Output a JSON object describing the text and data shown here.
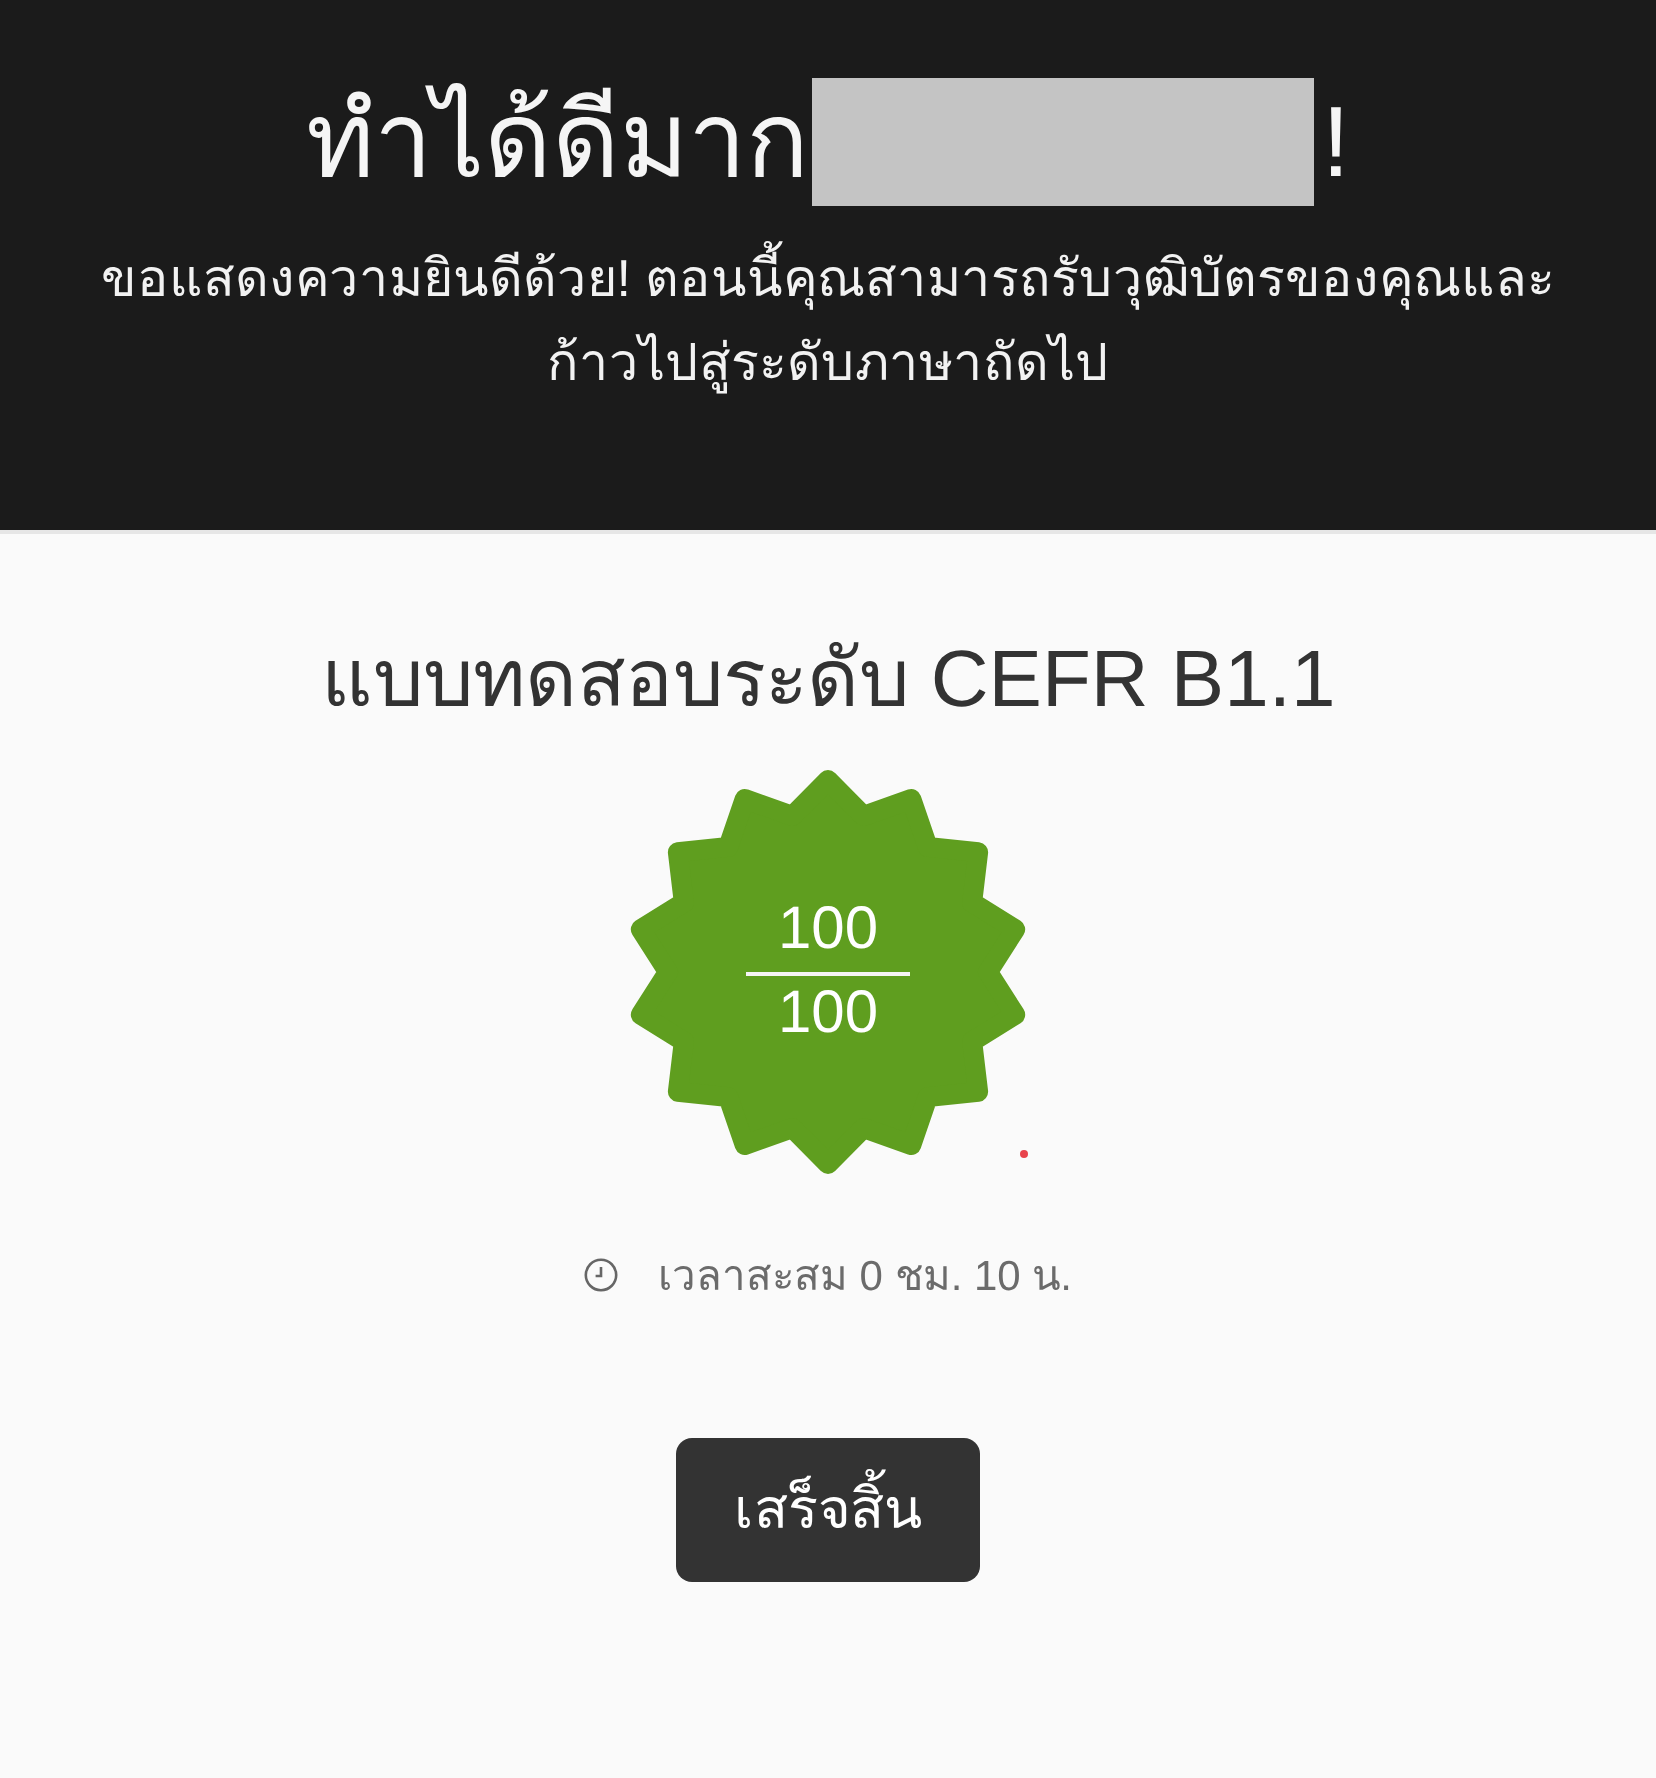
{
  "header": {
    "title_text": "ทำได้ดีมาก",
    "title_end": "!",
    "message": "ขอแสดงความยินดีด้วย! ตอนนี้คุณสามารถรับวุฒิบัตรของคุณและ\nก้าวไปสู่ระดับภาษาถัดไป"
  },
  "result": {
    "title": "แบบทดสอบระดับ CEFR B1.1",
    "score": "100",
    "max_score": "100",
    "time_spent": "เวลาสะสม 0 ชม. 10 น."
  },
  "finish_button": {
    "label": "เสร็จสิ้น"
  }
}
